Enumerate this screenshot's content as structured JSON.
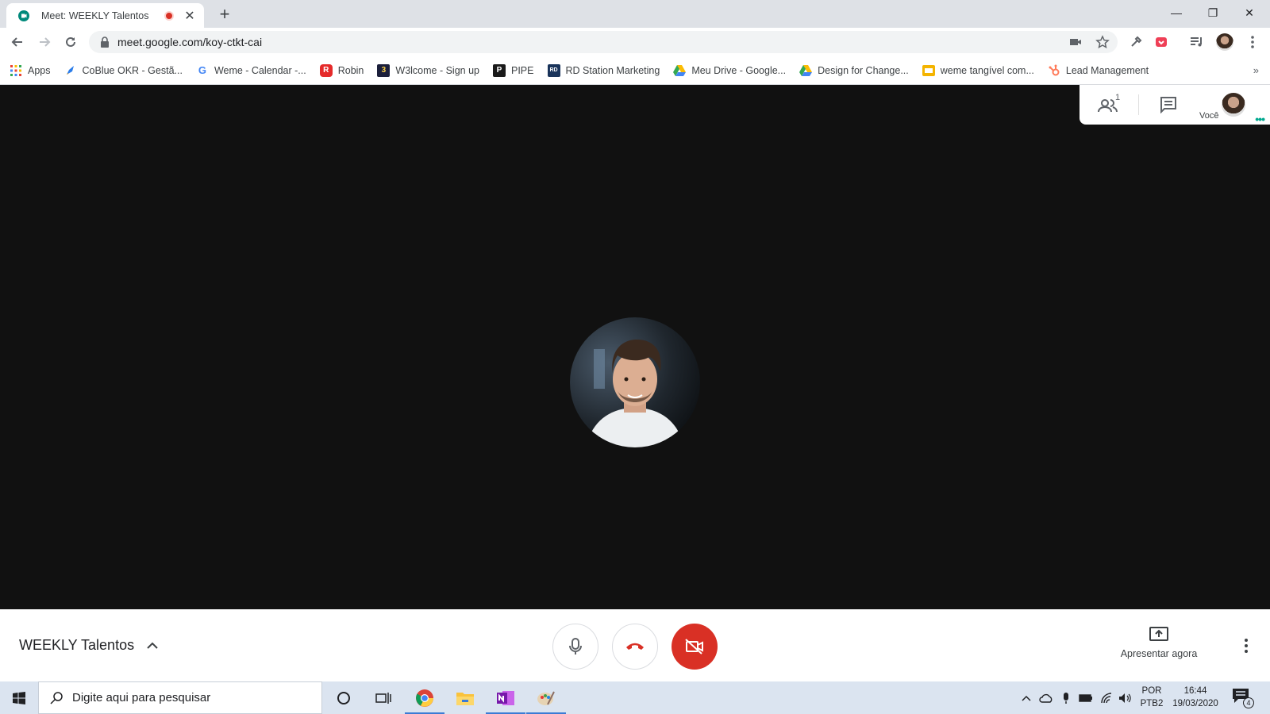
{
  "browser": {
    "tab": {
      "title": "Meet: WEEKLY Talentos",
      "close_glyph": "✕"
    },
    "new_tab_glyph": "+",
    "window_controls": {
      "minimize": "—",
      "restore": "❐",
      "close": "✕"
    },
    "address": {
      "url": "meet.google.com/koy-ctkt-cai"
    },
    "bookmarks": [
      {
        "label": "Apps",
        "icon": "apps-grid-icon"
      },
      {
        "label": "CoBlue OKR - Gestã...",
        "icon": "rocket-icon"
      },
      {
        "label": "Weme - Calendar -...",
        "icon": "google-g-icon",
        "glyph": "G"
      },
      {
        "label": "Robin",
        "icon": "robin-r-icon",
        "glyph": "R"
      },
      {
        "label": "W3lcome - Sign up",
        "icon": "w3lcome-icon",
        "glyph": "3"
      },
      {
        "label": "PIPE",
        "icon": "pipedrive-p-icon",
        "glyph": "P"
      },
      {
        "label": "RD Station Marketing",
        "icon": "rd-station-icon",
        "glyph": "RD"
      },
      {
        "label": "Meu Drive - Google...",
        "icon": "google-drive-icon"
      },
      {
        "label": "Design for Change...",
        "icon": "google-drive-icon"
      },
      {
        "label": "weme tangível com...",
        "icon": "slides-icon"
      },
      {
        "label": "Lead Management",
        "icon": "hubspot-icon"
      }
    ],
    "bookmarks_overflow": "»"
  },
  "meet": {
    "people_count": "1",
    "self_label": "Você",
    "self_dots": "•••",
    "meeting_title": "WEEKLY Talentos",
    "present_label": "Apresentar agora",
    "colors": {
      "hangup_red": "#d93025",
      "camera_off_red": "#d93025",
      "stage_bg": "#111111"
    }
  },
  "taskbar": {
    "search_placeholder": "Digite aqui para pesquisar",
    "language": {
      "line1": "POR",
      "line2": "PTB2"
    },
    "clock": {
      "time": "16:44",
      "date": "19/03/2020"
    },
    "notification_count": "4"
  }
}
